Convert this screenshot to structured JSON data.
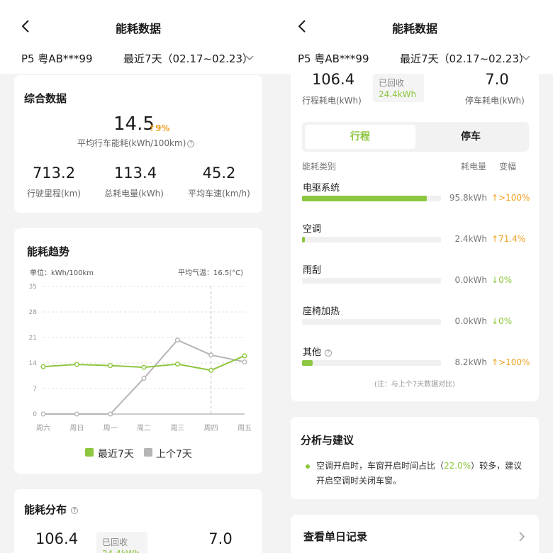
{
  "header": {
    "title": "能耗数据",
    "vehicle": "P5 粤AB***99",
    "range": "最近7天（02.17~02.23）"
  },
  "summary": {
    "title": "综合数据",
    "avg_consumption": "14.5",
    "avg_change": "9%",
    "avg_label": "平均行车能耗(kWh/100km)",
    "stats": [
      {
        "value": "713.2",
        "label": "行驶里程(km)"
      },
      {
        "value": "113.4",
        "label": "总耗电量(kWh)"
      },
      {
        "value": "45.2",
        "label": "平均车速(km/h)"
      }
    ]
  },
  "trend": {
    "title": "能耗趋势",
    "unit": "单位：kWh/100km",
    "temp": "平均气温：16.5(°C)",
    "legend_recent": "最近7天",
    "legend_prev": "上个7天",
    "colors": {
      "recent": "#8dc63f",
      "prev": "#b5b5b5"
    },
    "chart_data": {
      "type": "line",
      "categories": [
        "周六",
        "周日",
        "周一",
        "周二",
        "周三",
        "周四",
        "周五"
      ],
      "ylim": [
        0,
        35
      ],
      "yticks": [
        0,
        7,
        14,
        21,
        28,
        35
      ],
      "grid": true,
      "legend": "bottom",
      "highlight_index": 5,
      "series": [
        {
          "name": "最近7天",
          "values": [
            13.0,
            13.6,
            13.3,
            12.8,
            13.7,
            12.0,
            16.0
          ]
        },
        {
          "name": "上个7天",
          "values": [
            0,
            0,
            0,
            9.8,
            20.3,
            16.2,
            14.3
          ]
        }
      ]
    }
  },
  "distribution": {
    "title": "能耗分布",
    "drive_energy": "106.4",
    "drive_label": "行程耗电(kWh)",
    "recovered_label": "已回收",
    "recovered_value": "24.4kWh",
    "park_energy": "7.0",
    "park_label": "停车耗电(kWh)",
    "tabs": [
      "行程",
      "停车"
    ],
    "columns": {
      "category": "能耗类别",
      "usage": "耗电量",
      "change": "变幅"
    },
    "items": [
      {
        "name": "电驱系统",
        "share": 0.9,
        "value": "95.8kWh",
        "change": ">100%",
        "dir": "up"
      },
      {
        "name": "空调",
        "share": 0.02,
        "value": "2.4kWh",
        "change": "71.4%",
        "dir": "up"
      },
      {
        "name": "雨刮",
        "share": 0.0,
        "value": "0.0kWh",
        "change": "0%",
        "dir": "down"
      },
      {
        "name": "座椅加热",
        "share": 0.0,
        "value": "0.0kWh",
        "change": "0%",
        "dir": "down"
      },
      {
        "name": "其他",
        "share": 0.077,
        "value": "8.2kWh",
        "change": ">100%",
        "dir": "up"
      }
    ],
    "note": "(注：与上个7天数据对比)"
  },
  "analysis": {
    "title": "分析与建议",
    "text_before": "空调开启时，车窗开启时间占比（",
    "highlight": "22.0%",
    "text_after": "）较多，建议开启空调时关闭车窗。"
  },
  "daily_records": {
    "label": "查看单日记录"
  }
}
